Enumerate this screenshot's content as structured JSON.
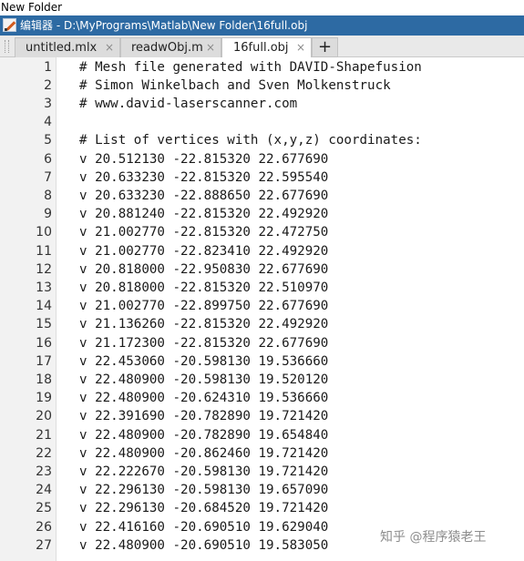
{
  "top_strip": {
    "text": "New Folder"
  },
  "window": {
    "title": "编辑器 - D:\\MyPrograms\\Matlab\\New Folder\\16full.obj"
  },
  "tabs": [
    {
      "label": "untitled.mlx",
      "active": false
    },
    {
      "label": "readwObj.m",
      "active": false
    },
    {
      "label": "16full.obj",
      "active": true
    }
  ],
  "close_glyph": "×",
  "new_tab_glyph": "+",
  "editor": {
    "lines": [
      {
        "num": "1",
        "text": "# Mesh file generated with DAVID-Shapefusion"
      },
      {
        "num": "2",
        "text": "# Simon Winkelbach and Sven Molkenstruck"
      },
      {
        "num": "3",
        "text": "# www.david-laserscanner.com"
      },
      {
        "num": "4",
        "text": ""
      },
      {
        "num": "5",
        "text": "# List of vertices with (x,y,z) coordinates:"
      },
      {
        "num": "6",
        "text": "v 20.512130 -22.815320 22.677690"
      },
      {
        "num": "7",
        "text": "v 20.633230 -22.815320 22.595540"
      },
      {
        "num": "8",
        "text": "v 20.633230 -22.888650 22.677690"
      },
      {
        "num": "9",
        "text": "v 20.881240 -22.815320 22.492920"
      },
      {
        "num": "10",
        "text": "v 21.002770 -22.815320 22.472750"
      },
      {
        "num": "11",
        "text": "v 21.002770 -22.823410 22.492920"
      },
      {
        "num": "12",
        "text": "v 20.818000 -22.950830 22.677690"
      },
      {
        "num": "13",
        "text": "v 20.818000 -22.815320 22.510970"
      },
      {
        "num": "14",
        "text": "v 21.002770 -22.899750 22.677690"
      },
      {
        "num": "15",
        "text": "v 21.136260 -22.815320 22.492920"
      },
      {
        "num": "16",
        "text": "v 21.172300 -22.815320 22.677690"
      },
      {
        "num": "17",
        "text": "v 22.453060 -20.598130 19.536660"
      },
      {
        "num": "18",
        "text": "v 22.480900 -20.598130 19.520120"
      },
      {
        "num": "19",
        "text": "v 22.480900 -20.624310 19.536660"
      },
      {
        "num": "20",
        "text": "v 22.391690 -20.782890 19.721420"
      },
      {
        "num": "21",
        "text": "v 22.480900 -20.782890 19.654840"
      },
      {
        "num": "22",
        "text": "v 22.480900 -20.862460 19.721420"
      },
      {
        "num": "23",
        "text": "v 22.222670 -20.598130 19.721420"
      },
      {
        "num": "24",
        "text": "v 22.296130 -20.598130 19.657090"
      },
      {
        "num": "25",
        "text": "v 22.296130 -20.684520 19.721420"
      },
      {
        "num": "26",
        "text": "v 22.416160 -20.690510 19.629040"
      },
      {
        "num": "27",
        "text": "v 22.480900 -20.690510 19.583050"
      }
    ]
  },
  "watermark": {
    "text": "知乎 @程序猿老王"
  }
}
